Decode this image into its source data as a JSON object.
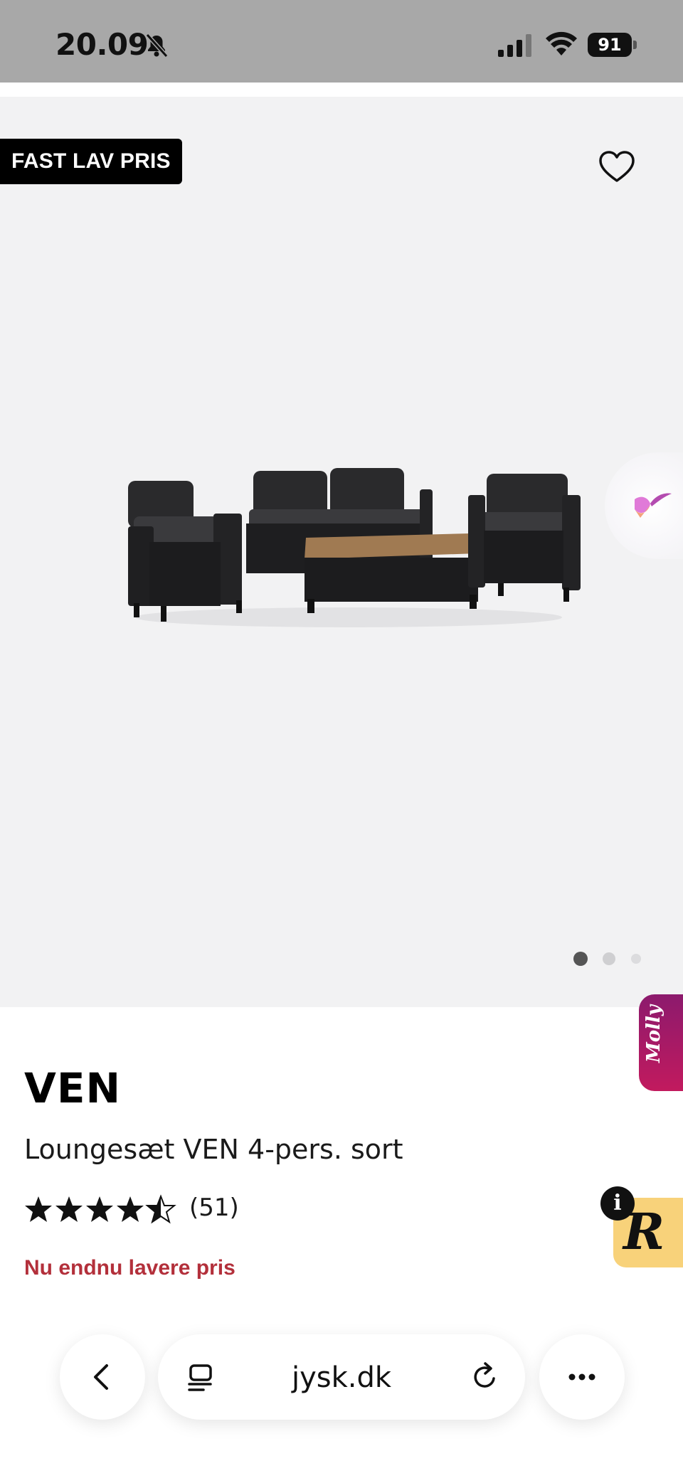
{
  "status_bar": {
    "time": "20.09",
    "battery": "91",
    "icons": [
      "bell-slash-icon",
      "signal-icon",
      "wifi-icon",
      "battery-icon"
    ]
  },
  "hero": {
    "badge": "FAST LAV PRIS",
    "favorite_icon": "heart-icon",
    "carousel": {
      "total": 3,
      "active": 1
    },
    "colors": {
      "background": "#f2f2f3"
    }
  },
  "product": {
    "brand": "VEN",
    "name": "Loungesæt VEN 4-pers. sort",
    "rating": 4.5,
    "rating_max": 5,
    "reviews": "(51)",
    "price_note": "Nu endnu lavere pris"
  },
  "widgets": {
    "molly": "Molly",
    "r_badge": "R",
    "info": "i"
  },
  "browser": {
    "url": "jysk.dk",
    "icons": [
      "back-icon",
      "tabs-icon",
      "reload-icon",
      "more-icon"
    ]
  },
  "colors": {
    "accent_red": "#b3303b",
    "molly_purple": "#8c1a6d",
    "r_yellow": "#f8d27a"
  }
}
